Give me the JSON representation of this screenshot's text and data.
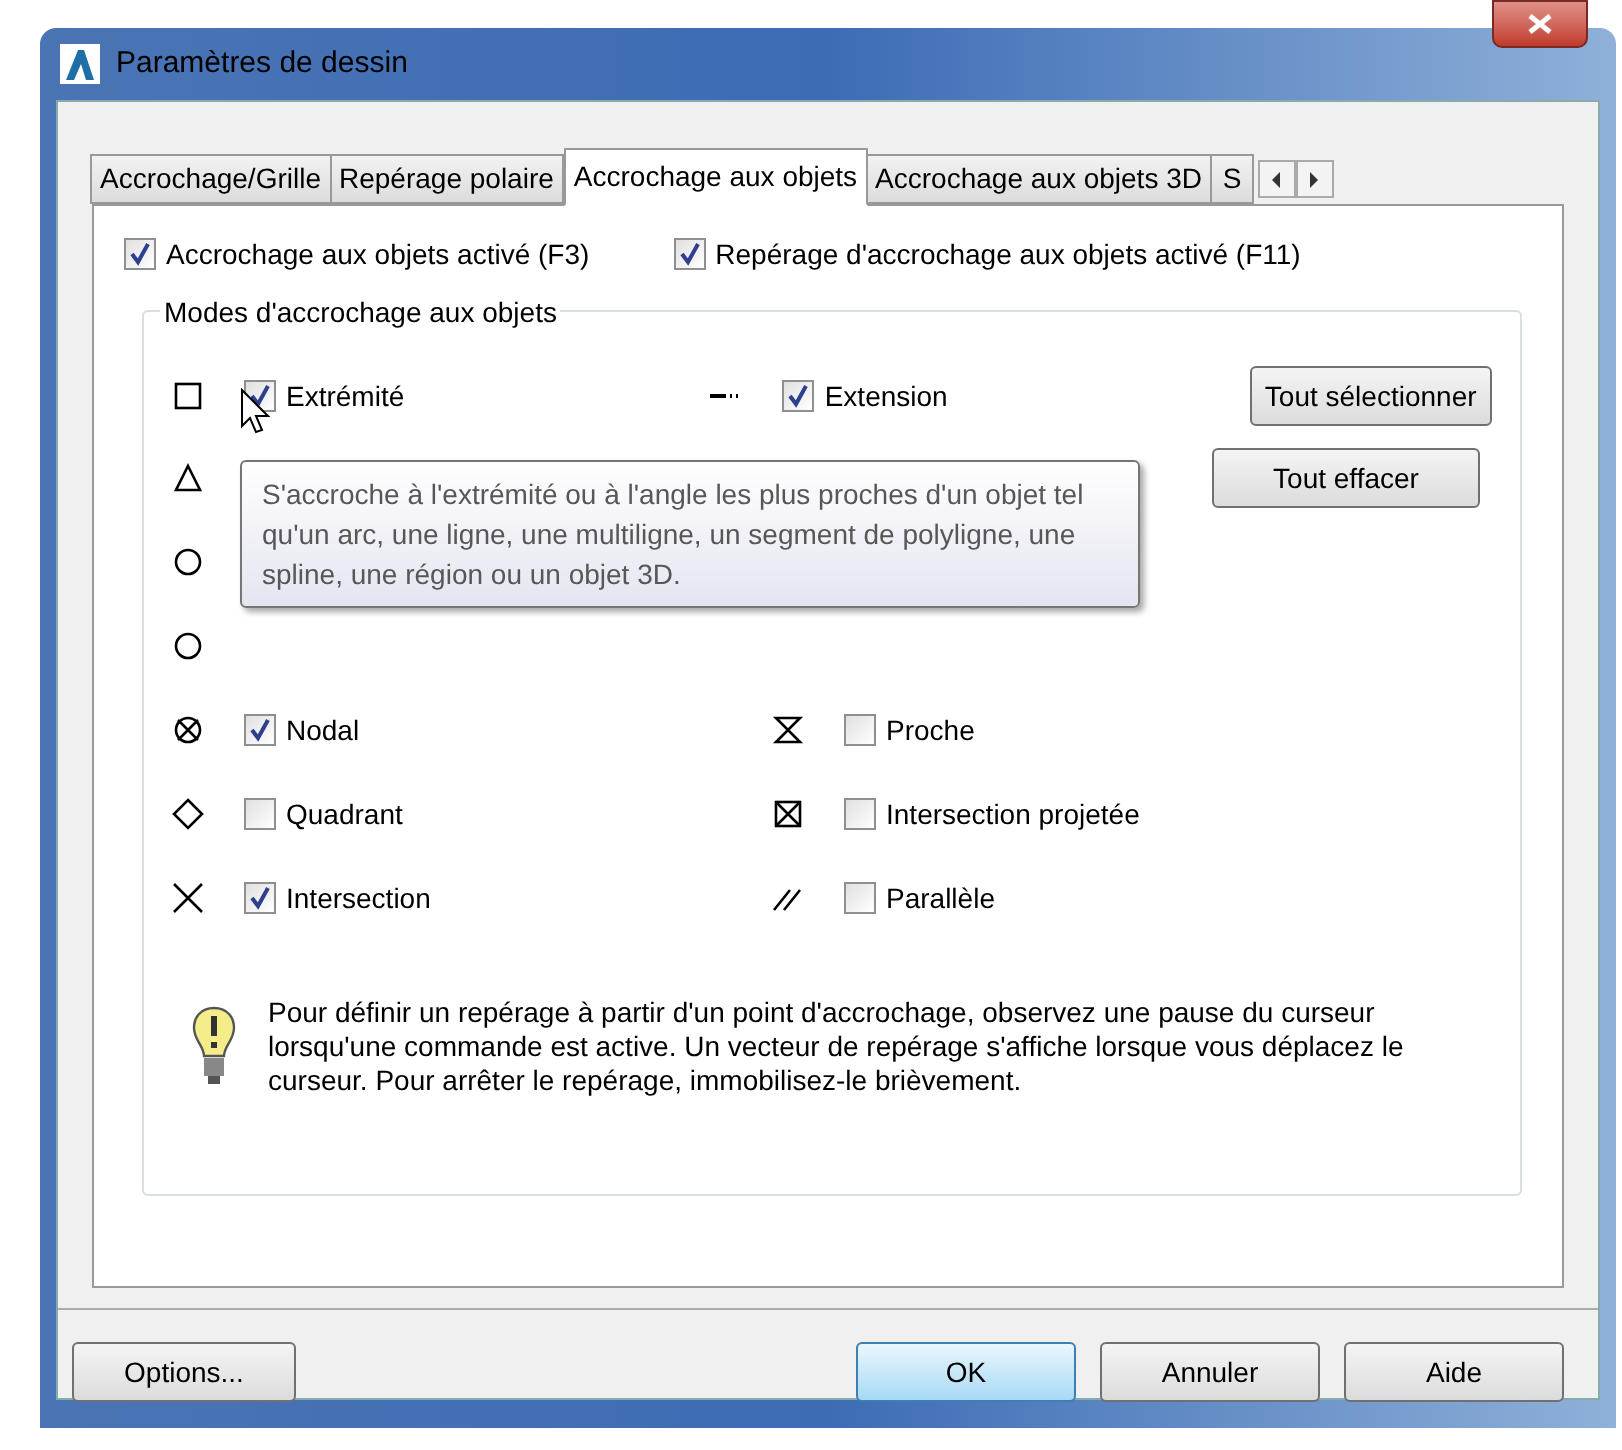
{
  "window": {
    "title": "Paramètres de dessin"
  },
  "tabs": [
    {
      "label": "Accrochage/Grille",
      "selected": false
    },
    {
      "label": "Repérage polaire",
      "selected": false
    },
    {
      "label": "Accrochage aux objets",
      "selected": true
    },
    {
      "label": "Accrochage aux objets 3D",
      "selected": false
    },
    {
      "label": "S",
      "selected": false
    }
  ],
  "toggles": [
    {
      "label": "Accrochage aux objets activé (F3)",
      "checked": true
    },
    {
      "label": "Repérage d'accrochage aux objets activé (F11)",
      "checked": true
    }
  ],
  "group": {
    "title": "Modes d'accrochage aux objets",
    "modes": [
      {
        "label": "Extrémité",
        "checked": true
      },
      {
        "label": "Extension",
        "checked": true
      },
      {
        "label": "Nodal",
        "checked": true
      },
      {
        "label": "Proche",
        "checked": false
      },
      {
        "label": "Quadrant",
        "checked": false
      },
      {
        "label": "Intersection projetée",
        "checked": false
      },
      {
        "label": "Intersection",
        "checked": true
      },
      {
        "label": "Parallèle",
        "checked": false
      }
    ],
    "buttons": [
      "Tout sélectionner",
      "Tout effacer"
    ],
    "tooltip": "S'accroche à l'extrémité ou à l'angle les plus proches d'un objet tel qu'un arc, une ligne, une multiligne, un segment de polyligne, une spline, une région ou un objet 3D.",
    "info": "Pour définir un repérage à partir d'un point d'accrochage, observez une pause du curseur lorsqu'une commande est active. Un vecteur de repérage s'affiche lorsque vous déplacez le curseur. Pour arrêter le repérage, immobilisez-le brièvement."
  },
  "footer": {
    "left": "Options...",
    "buttons": [
      "OK",
      "Annuler",
      "Aide"
    ]
  }
}
